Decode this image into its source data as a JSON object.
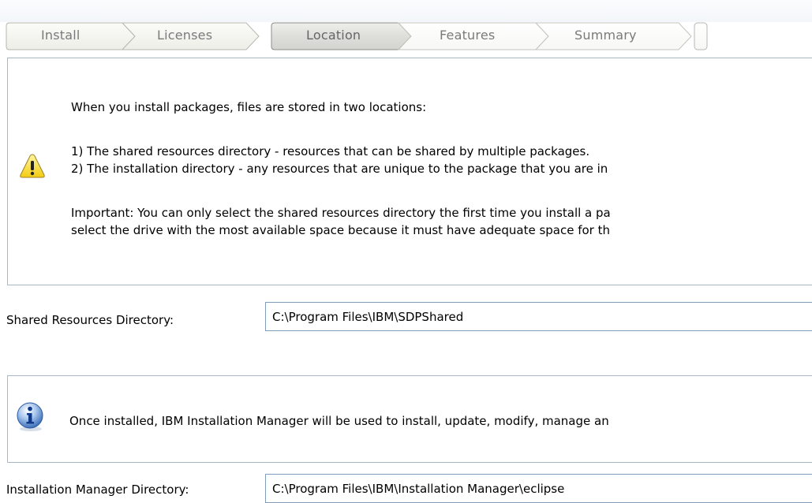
{
  "wizard_steps": [
    {
      "label": "Install",
      "state": "done"
    },
    {
      "label": "Licenses",
      "state": "done"
    },
    {
      "label": "Location",
      "state": "current"
    },
    {
      "label": "Features",
      "state": "pending"
    },
    {
      "label": "Summary",
      "state": "pending"
    }
  ],
  "warning_panel": {
    "icon": "warning-triangle-icon",
    "intro": "When you install packages, files are stored in two locations:",
    "item1": "1) The shared resources directory - resources that can be shared by multiple packages.",
    "item2": "2) The installation directory - any resources that are unique to the package that you are in",
    "important_line1": "Important: You can only select the shared resources directory the first time you install a pa",
    "important_line2": "select the drive with the most available space because it must have adequate space for th"
  },
  "shared_resources": {
    "label": "Shared Resources Directory:",
    "value": "C:\\Program Files\\IBM\\SDPShared"
  },
  "info_panel": {
    "icon": "info-icon",
    "text": "Once installed, IBM Installation Manager will be used to install, update, modify, manage an"
  },
  "installation_manager": {
    "label": "Installation Manager Directory:",
    "value": "C:\\Program Files\\IBM\\Installation Manager\\eclipse"
  },
  "colors": {
    "panel_border": "#a9b8c8",
    "input_border": "#7f9db9",
    "step_text": "#7a7a7a"
  }
}
